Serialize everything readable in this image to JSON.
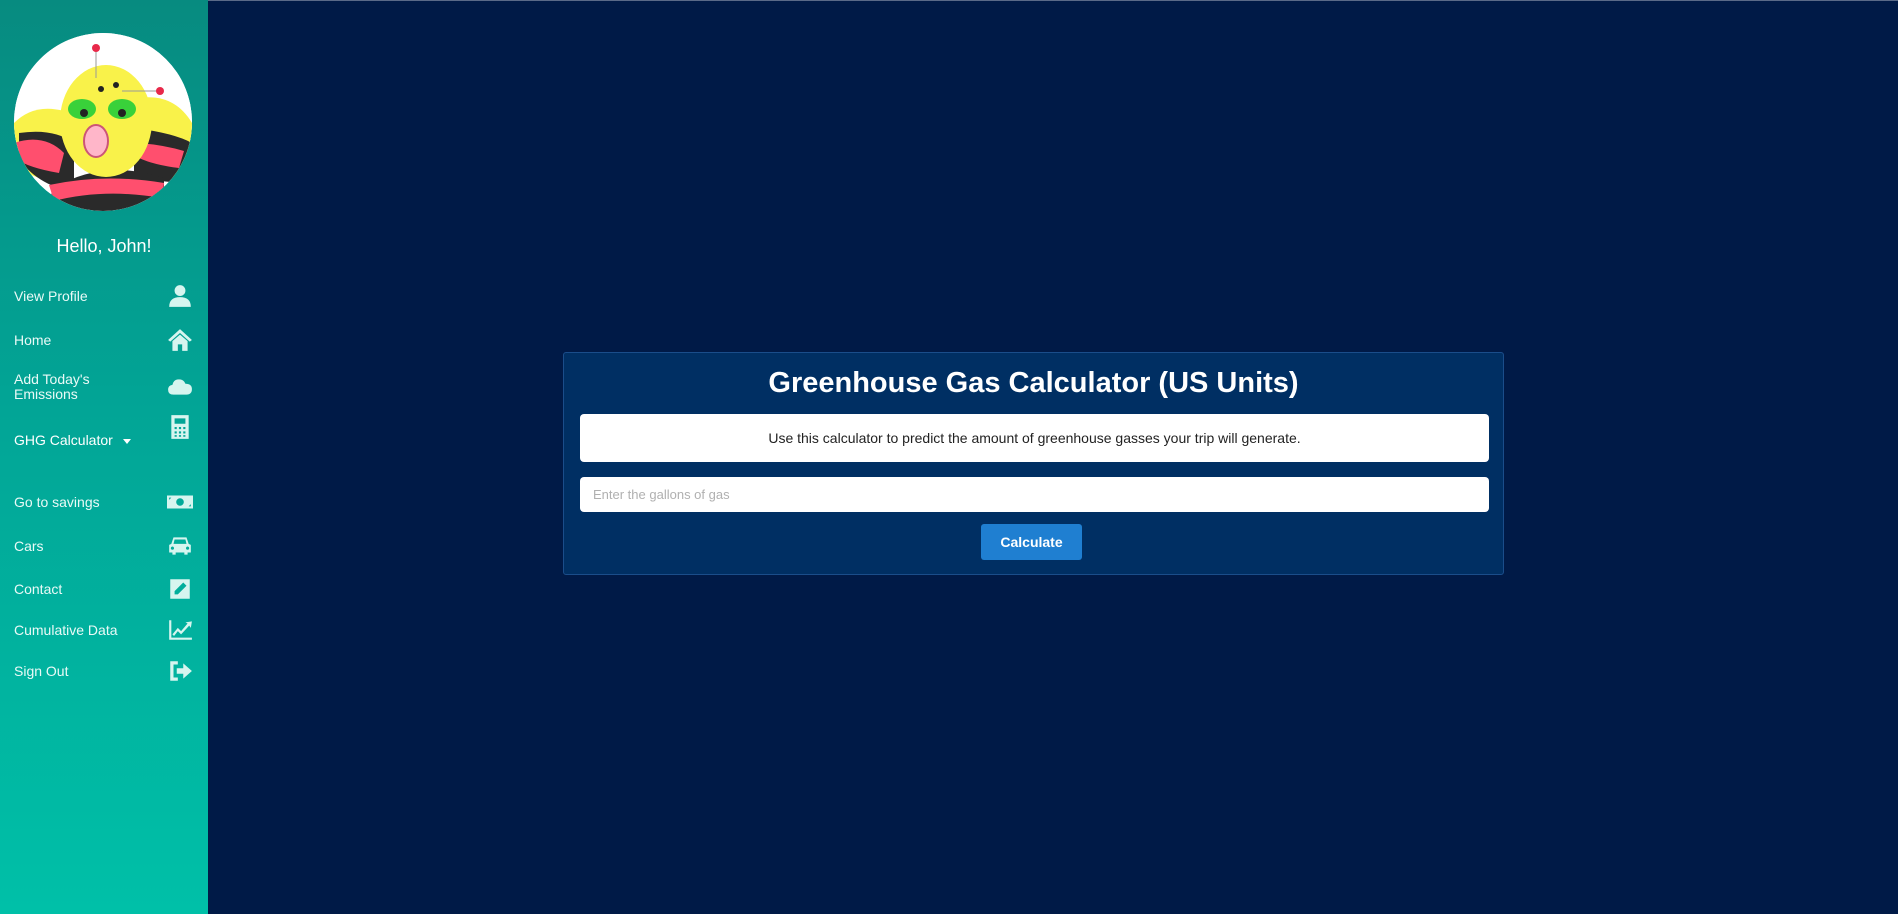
{
  "sidebar": {
    "greeting": "Hello, John!",
    "items": [
      {
        "label": "View Profile",
        "icon": "user-icon"
      },
      {
        "label": "Home",
        "icon": "home-icon"
      },
      {
        "label": "Add Today's Emissions",
        "icon": "cloud-icon"
      },
      {
        "label": "GHG Calculator",
        "icon": "calculator-icon"
      },
      {
        "label": "Go to savings",
        "icon": "money-bill-icon"
      },
      {
        "label": "Cars",
        "icon": "car-icon"
      },
      {
        "label": "Contact",
        "icon": "edit-icon"
      },
      {
        "label": "Cumulative Data",
        "icon": "chart-line-icon"
      },
      {
        "label": "Sign Out",
        "icon": "sign-out-icon"
      }
    ]
  },
  "main": {
    "title": "Greenhouse Gas Calculator (US Units)",
    "description": "Use this calculator to predict the amount of greenhouse gasses your trip will generate.",
    "input": {
      "placeholder": "Enter the gallons of gas",
      "value": ""
    },
    "button_label": "Calculate"
  },
  "colors": {
    "background": "#001a47",
    "sidebar_top": "#078b80",
    "sidebar_bottom": "#00c0a8",
    "card": "#002f63",
    "button": "#1f7fd1"
  }
}
